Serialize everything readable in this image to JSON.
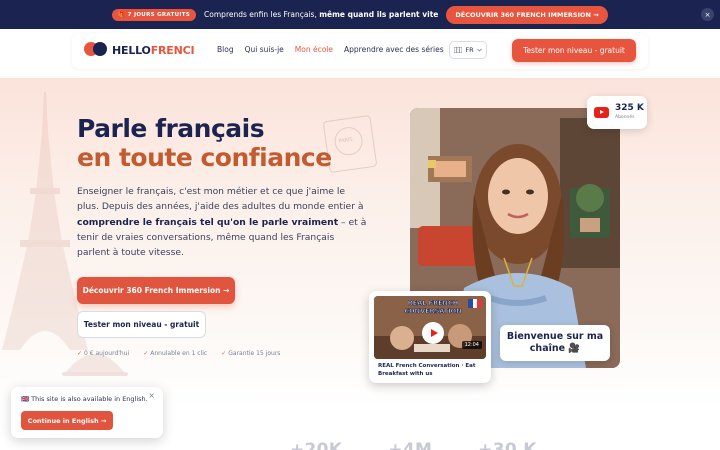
{
  "announcement": {
    "badge": "🎁 7 JOURS GRATUITS",
    "text_prefix": "Comprends enfin les Français, ",
    "text_bold": "même quand ils parlent vite",
    "button": "DÉCOUVRIR 360 FRENCH IMMERSION →",
    "close_icon": "×"
  },
  "nav": {
    "logo_main": "HELLO",
    "logo_accent": "FRENCI",
    "links": [
      "Blog",
      "Qui suis-je",
      "Mon école",
      "Apprendre avec des séries"
    ],
    "active_link": "Mon école",
    "language": "FR",
    "cta": "Tester mon niveau - gratuit"
  },
  "hero": {
    "title_line1": "Parle français",
    "title_line2": "en toute confiance",
    "para_part1": "Enseigner le français, c'est mon métier et ce que j'aime le plus. Depuis des années, j'aide des adultes du monde entier à ",
    "para_bold": "comprendre le français tel qu'on le parle vraiment",
    "para_part2": " – et à tenir de vraies conversations, même quand les Français parlent à toute vitesse.",
    "primary_button": "Découvrir 360 French Immersion →",
    "secondary_button": "Tester mon niveau - gratuit",
    "guarantees": [
      "0 € aujourd'hui",
      "Annulable en 1 clic",
      "Garantie 15 jours"
    ],
    "check_icon": "✓",
    "stamp_text": "PARIS"
  },
  "youtube": {
    "count": "325 K",
    "label": "Abonnés"
  },
  "video_card": {
    "thumb_title": "REAL FRENCH CONVERSATION",
    "duration": "12:04",
    "title": "REAL French Conversation · Eat Breakfast with us"
  },
  "welcome_bubble": "Bienvenue sur ma chaîne 🎥",
  "toast": {
    "text": "🇬🇧 This site is also available in English.",
    "close_icon": "×",
    "button": "Continue in English →"
  },
  "stats_preview": [
    "+20K",
    "+4M",
    "+30 K"
  ],
  "colors": {
    "navy": "#1b2450",
    "accent": "#e8553f",
    "title_accent": "#c25b30"
  }
}
